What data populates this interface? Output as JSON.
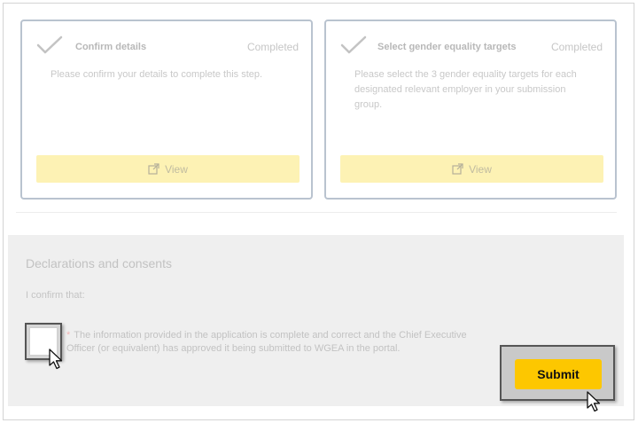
{
  "steps": [
    {
      "title": "Confirm details",
      "status": "Completed",
      "description": "Please confirm your details to complete this step.",
      "view_label": "View",
      "check_icon": "check-icon",
      "view_icon": "external-link-icon"
    },
    {
      "title": "Select gender equality targets",
      "status": "Completed",
      "description": "Please select the 3 gender equality targets for each designated relevant employer in your submission group.",
      "view_label": "View",
      "check_icon": "check-icon",
      "view_icon": "external-link-icon"
    }
  ],
  "declarations": {
    "title": "Declarations and consents",
    "subtitle": "I confirm that:",
    "required_marker": "*",
    "consent_text": "The information provided in the application is complete and correct and the Chief Executive Officer (or equivalent) has approved it being submitted to WGEA in the portal.",
    "checked": false
  },
  "actions": {
    "submit_label": "Submit"
  },
  "colors": {
    "accent_yellow": "#fdc700",
    "view_button": "#fdf2b4",
    "card_border": "#b9c3cf",
    "panel_background": "#efefef"
  }
}
